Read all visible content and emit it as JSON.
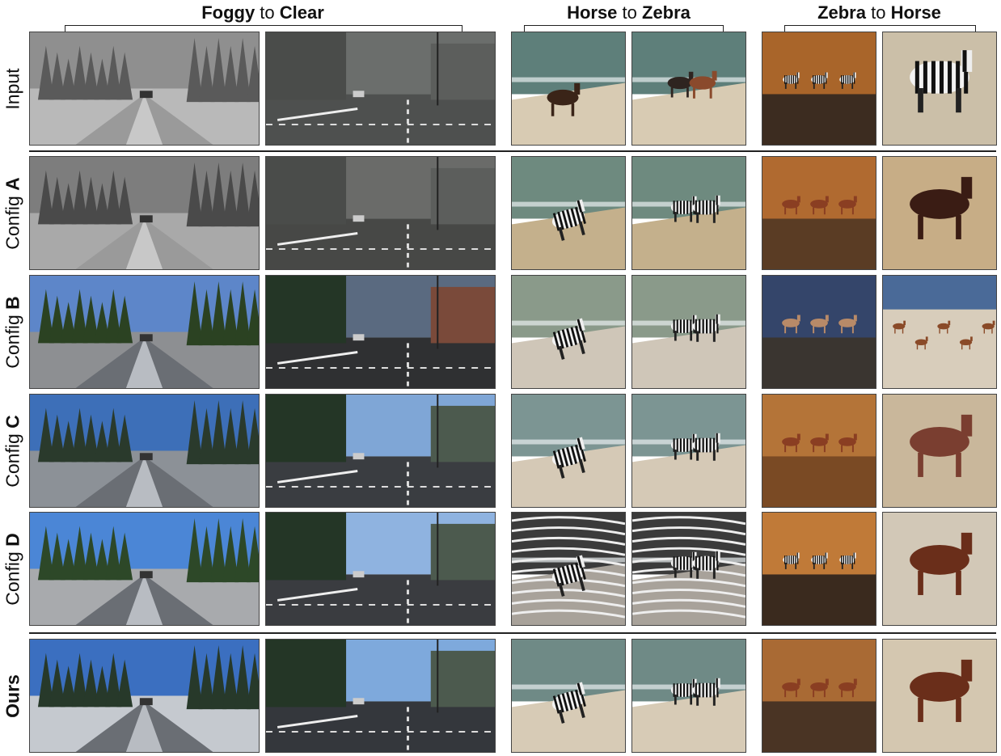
{
  "columns": [
    {
      "pre": "Foggy",
      "mid": " to ",
      "post": "Clear"
    },
    {
      "pre": "Horse",
      "mid": " to ",
      "post": "Zebra"
    },
    {
      "pre": "Zebra",
      "mid": " to ",
      "post": "Horse"
    }
  ],
  "rows": [
    {
      "prefix": "Input",
      "bold": ""
    },
    {
      "prefix": "Config ",
      "bold": "A"
    },
    {
      "prefix": "Config ",
      "bold": "B"
    },
    {
      "prefix": "Config ",
      "bold": "C"
    },
    {
      "prefix": "Config ",
      "bold": "D"
    },
    {
      "prefix": "",
      "bold": "Ours"
    }
  ],
  "images": {
    "road1": "snowy-road-scene",
    "road2": "city-street-scene",
    "beach1": "beach-lying-animal",
    "beach2": "beach-standing-animals",
    "savanna1": "savanna-herd",
    "savanna2": "savanna-single-animal"
  },
  "colors": {
    "fog_sky": "#8a8a8a",
    "clear_sky": "#3c6fb8",
    "sand": "#d8c9ae",
    "sea": "#4e7a78",
    "savanna_orange": "#b06a2e",
    "horse_brown": "#7a3a1e"
  }
}
